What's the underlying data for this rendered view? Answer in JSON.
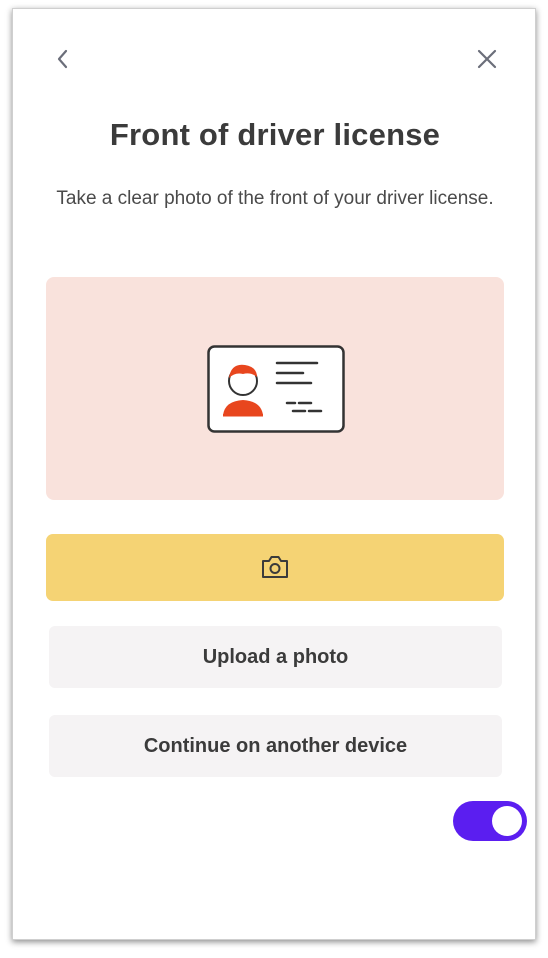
{
  "header": {
    "title": "Front of driver license",
    "subtitle": "Take a clear photo of the front of your driver license."
  },
  "icons": {
    "back": "chevron-left-icon",
    "close": "close-icon",
    "illustration": "id-card-icon",
    "camera": "camera-icon"
  },
  "actions": {
    "upload_label": "Upload a photo",
    "continue_label": "Continue on another device"
  },
  "toggle": {
    "state": "on"
  },
  "colors": {
    "illustration_bg": "#f9e2dc",
    "primary_button": "#f5d374",
    "secondary_button": "#f5f3f4",
    "toggle_on": "#5b1ef0",
    "avatar_accent": "#e8461e",
    "text": "#3b3b3b"
  }
}
